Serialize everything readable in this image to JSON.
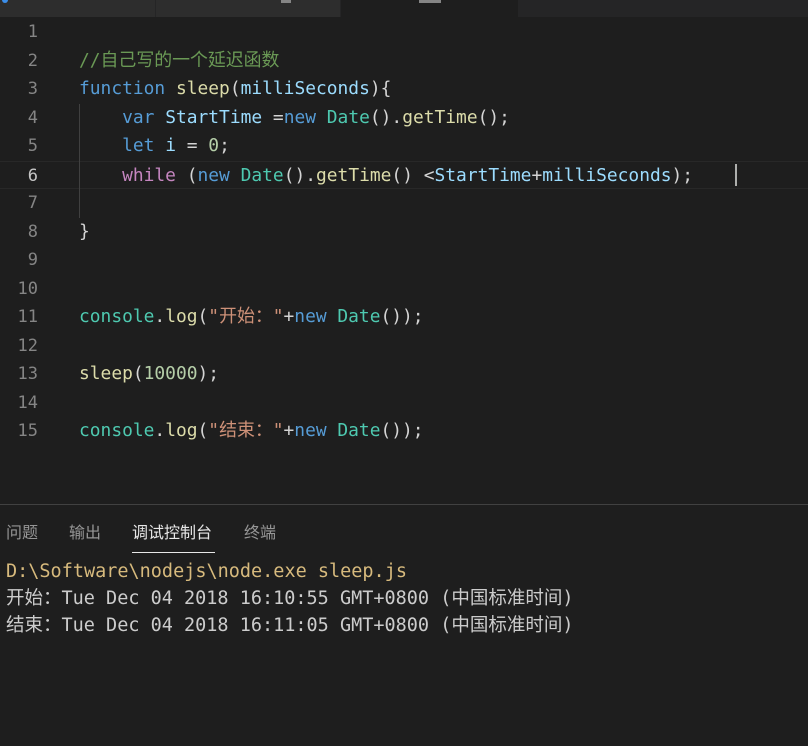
{
  "editor": {
    "lines": [
      {
        "n": "1",
        "tokens": []
      },
      {
        "n": "2",
        "tokens": [
          {
            "c": "t-comment",
            "t": "//自己写的一个延迟函数"
          }
        ]
      },
      {
        "n": "3",
        "tokens": [
          {
            "c": "t-kw",
            "t": "function "
          },
          {
            "c": "t-fn",
            "t": "sleep"
          },
          {
            "c": "t-plain",
            "t": "("
          },
          {
            "c": "t-param",
            "t": "milliSeconds"
          },
          {
            "c": "t-plain",
            "t": "){"
          }
        ]
      },
      {
        "n": "4",
        "tokens": [
          {
            "c": "t-plain",
            "t": "    "
          },
          {
            "c": "t-kw",
            "t": "var "
          },
          {
            "c": "t-param",
            "t": "StartTime"
          },
          {
            "c": "t-plain",
            "t": " ="
          },
          {
            "c": "t-kw",
            "t": "new "
          },
          {
            "c": "t-type",
            "t": "Date"
          },
          {
            "c": "t-plain",
            "t": "()."
          },
          {
            "c": "t-fn",
            "t": "getTime"
          },
          {
            "c": "t-plain",
            "t": "();"
          }
        ]
      },
      {
        "n": "5",
        "tokens": [
          {
            "c": "t-plain",
            "t": "    "
          },
          {
            "c": "t-kw",
            "t": "let "
          },
          {
            "c": "t-param",
            "t": "i"
          },
          {
            "c": "t-plain",
            "t": " = "
          },
          {
            "c": "t-num",
            "t": "0"
          },
          {
            "c": "t-plain",
            "t": ";"
          }
        ]
      },
      {
        "n": "6",
        "tokens": [
          {
            "c": "t-plain",
            "t": "    "
          },
          {
            "c": "t-ctrl",
            "t": "while"
          },
          {
            "c": "t-plain",
            "t": " ("
          },
          {
            "c": "t-kw",
            "t": "new "
          },
          {
            "c": "t-type",
            "t": "Date"
          },
          {
            "c": "t-plain",
            "t": "()."
          },
          {
            "c": "t-fn",
            "t": "getTime"
          },
          {
            "c": "t-plain",
            "t": "() <"
          },
          {
            "c": "t-param",
            "t": "StartTime"
          },
          {
            "c": "t-plain",
            "t": "+"
          },
          {
            "c": "t-param",
            "t": "milliSeconds"
          },
          {
            "c": "t-plain",
            "t": ");"
          }
        ]
      },
      {
        "n": "7",
        "tokens": []
      },
      {
        "n": "8",
        "tokens": [
          {
            "c": "t-plain",
            "t": "}"
          }
        ]
      },
      {
        "n": "9",
        "tokens": []
      },
      {
        "n": "10",
        "tokens": []
      },
      {
        "n": "11",
        "tokens": [
          {
            "c": "t-type",
            "t": "console"
          },
          {
            "c": "t-plain",
            "t": "."
          },
          {
            "c": "t-fn",
            "t": "log"
          },
          {
            "c": "t-plain",
            "t": "("
          },
          {
            "c": "t-str",
            "t": "\"开始：\""
          },
          {
            "c": "t-plain",
            "t": "+"
          },
          {
            "c": "t-kw",
            "t": "new "
          },
          {
            "c": "t-type",
            "t": "Date"
          },
          {
            "c": "t-plain",
            "t": "());"
          }
        ]
      },
      {
        "n": "12",
        "tokens": []
      },
      {
        "n": "13",
        "tokens": [
          {
            "c": "t-fn",
            "t": "sleep"
          },
          {
            "c": "t-plain",
            "t": "("
          },
          {
            "c": "t-num",
            "t": "10000"
          },
          {
            "c": "t-plain",
            "t": ");"
          }
        ]
      },
      {
        "n": "14",
        "tokens": []
      },
      {
        "n": "15",
        "tokens": [
          {
            "c": "t-type",
            "t": "console"
          },
          {
            "c": "t-plain",
            "t": "."
          },
          {
            "c": "t-fn",
            "t": "log"
          },
          {
            "c": "t-plain",
            "t": "("
          },
          {
            "c": "t-str",
            "t": "\"结束：\""
          },
          {
            "c": "t-plain",
            "t": "+"
          },
          {
            "c": "t-kw",
            "t": "new "
          },
          {
            "c": "t-type",
            "t": "Date"
          },
          {
            "c": "t-plain",
            "t": "());"
          }
        ]
      }
    ],
    "active_line": "6"
  },
  "panel": {
    "tabs": [
      {
        "label": "问题",
        "active": false
      },
      {
        "label": "输出",
        "active": false
      },
      {
        "label": "调试控制台",
        "active": true
      },
      {
        "label": "终端",
        "active": false
      }
    ],
    "output": [
      {
        "text": "D:\\Software\\nodejs\\node.exe sleep.js",
        "kind": "cmd"
      },
      {
        "text": "开始：Tue Dec 04 2018 16:10:55 GMT+0800 (中国标准时间)",
        "kind": "log"
      },
      {
        "text": "结束：Tue Dec 04 2018 16:11:05 GMT+0800 (中国标准时间)",
        "kind": "log"
      }
    ]
  },
  "colors": {
    "background": "#1e1e1e",
    "comment": "#6a9955",
    "keyword": "#569cd6",
    "function": "#dcdcaa",
    "variable": "#9cdcfe",
    "type": "#4ec9b0",
    "number": "#b5cea8",
    "string": "#ce9178",
    "control": "#c586c0",
    "command_output": "#d7ba7d"
  }
}
